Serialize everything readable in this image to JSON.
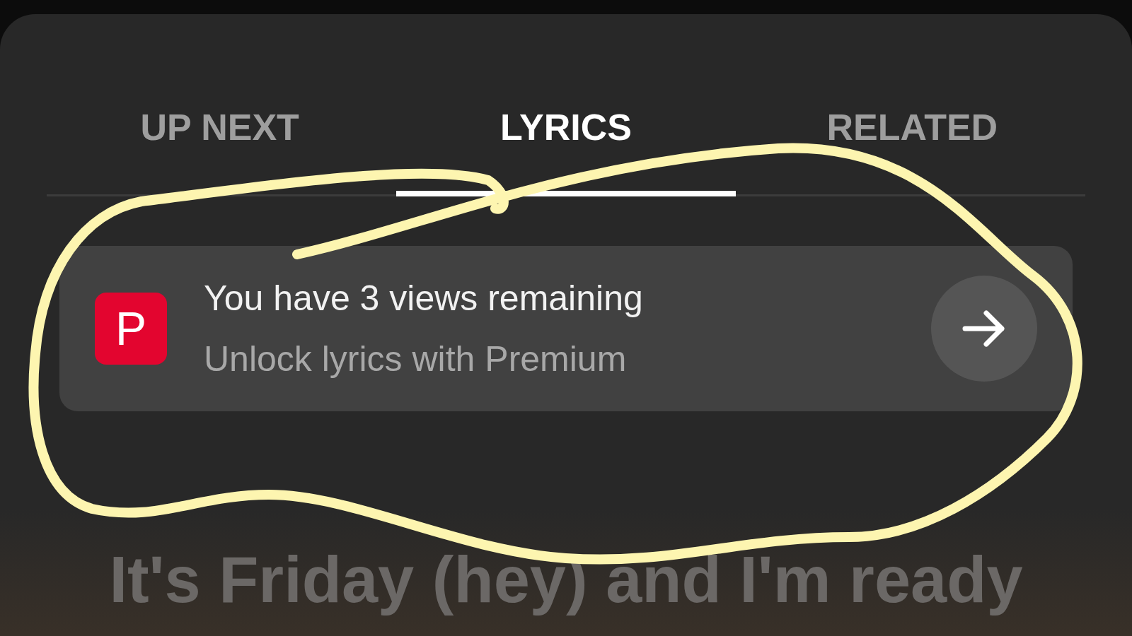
{
  "tabs": [
    {
      "label": "UP NEXT",
      "selected": false
    },
    {
      "label": "LYRICS",
      "selected": true
    },
    {
      "label": "RELATED",
      "selected": false
    }
  ],
  "promo": {
    "badge": "P",
    "title": "You have 3 views remaining",
    "subtitle": "Unlock lyrics with Premium"
  },
  "lyrics": [
    "It's Friday (hey) and I'm ready"
  ]
}
